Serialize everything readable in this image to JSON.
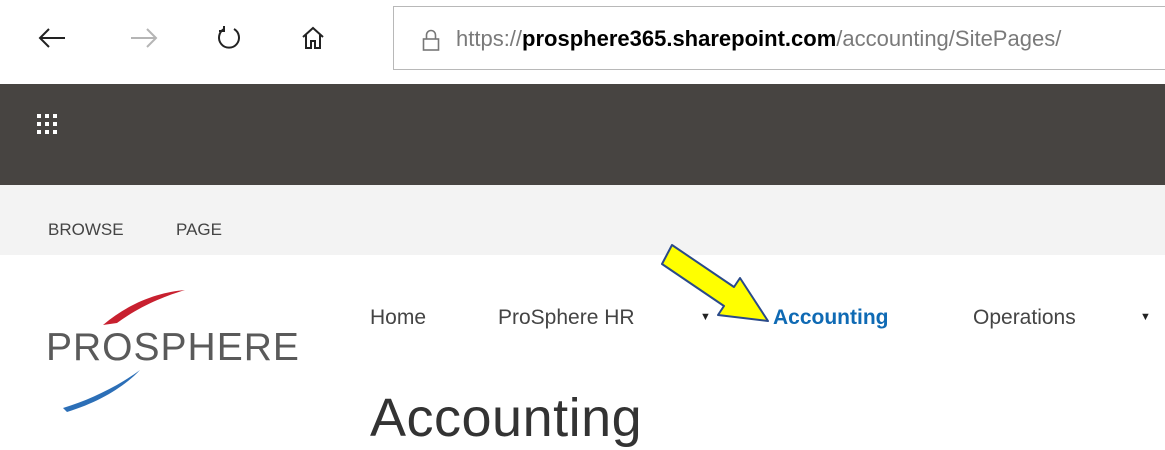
{
  "browser": {
    "url_prefix": "https://",
    "url_domain": "prosphere365.sharepoint.com",
    "url_path": "/accounting/SitePages/",
    "icons": [
      "back-arrow-icon",
      "forward-arrow-icon",
      "refresh-icon",
      "home-icon",
      "lock-icon"
    ]
  },
  "suite_bar": {
    "icon": "app-launcher-waffle-icon",
    "background": "#474441"
  },
  "ribbon": {
    "tabs": [
      "BROWSE",
      "PAGE"
    ]
  },
  "site": {
    "logo_text": "PROSPHERE",
    "nav": [
      {
        "label": "Home"
      },
      {
        "label": "ProSphere HR",
        "has_dropdown": true
      },
      {
        "label": "Accounting",
        "active": true
      },
      {
        "label": "Operations",
        "has_dropdown": true
      }
    ],
    "page_title": "Accounting",
    "accent_color": "#0f6ab4",
    "annotation": "yellow-arrow-pointing-to-accounting"
  }
}
